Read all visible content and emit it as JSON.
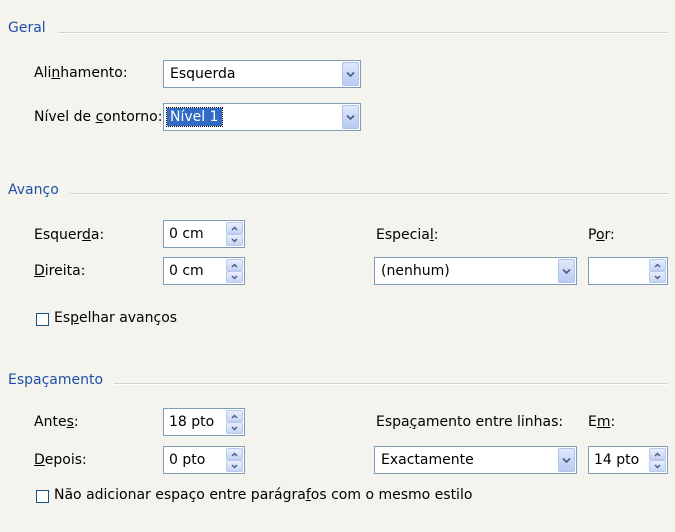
{
  "geral": {
    "title": "Geral",
    "alinhamento": {
      "pre": "Ali",
      "u": "n",
      "post": "hamento:",
      "value": "Esquerda"
    },
    "nivel": {
      "pre": "Nível de ",
      "u": "c",
      "post": "ontorno:",
      "value": "Nível 1"
    }
  },
  "avanco": {
    "title": "Avanço",
    "esquerda": {
      "pre": "Esquer",
      "u": "d",
      "post": "a:",
      "value": "0 cm"
    },
    "direita": {
      "pre": "",
      "u": "D",
      "post": "ireita:",
      "value": "0 cm"
    },
    "especial": {
      "pre": "Especia",
      "u": "l",
      "post": ":",
      "value": "(nenhum)"
    },
    "por": {
      "pre": "P",
      "u": "o",
      "post": "r:",
      "value": ""
    },
    "espelhar": {
      "pre": "Es",
      "u": "p",
      "post": "elhar avanços",
      "checked": false
    }
  },
  "espacamento": {
    "title": "Espaçamento",
    "antes": {
      "pre": "Ante",
      "u": "s",
      "post": ":",
      "value": "18 pto"
    },
    "depois": {
      "pre": "",
      "u": "D",
      "post": "epois:",
      "value": "0 pto"
    },
    "entre_linhas": {
      "pre": "Espa",
      "u": "ç",
      "post": "amento entre linhas:",
      "value": "Exactamente"
    },
    "em": {
      "pre": "E",
      "u": "m",
      "post": ":",
      "value": "14 pto"
    },
    "nao_adicionar": {
      "pre": "Não adicionar espaço entre parágra",
      "u": "f",
      "post": "os com o mesmo estilo",
      "checked": false
    }
  },
  "icons": {
    "dropdown": "chevron-down-icon",
    "spin_up": "chevron-up-icon",
    "spin_down": "chevron-down-icon"
  },
  "colors": {
    "section_title": "#1f4fa8",
    "selection": "#316ac5",
    "field_border": "#7f9db9",
    "background": "#f4f3ee"
  }
}
